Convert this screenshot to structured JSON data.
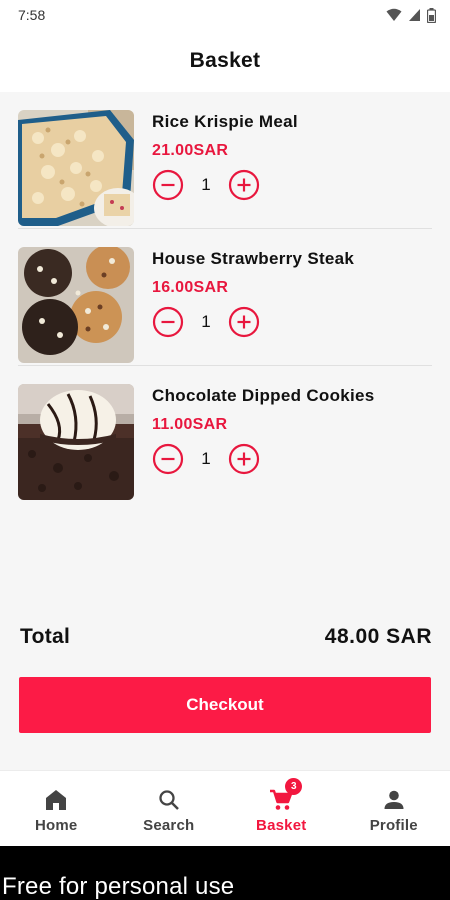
{
  "status_bar": {
    "time": "7:58"
  },
  "header": {
    "title": "Basket"
  },
  "items": [
    {
      "name": "Rice Krispie Meal",
      "price": "21.00SAR",
      "quantity": "1",
      "image": "rice-krispie-image"
    },
    {
      "name": "House Strawberry Steak",
      "price": "16.00SAR",
      "quantity": "1",
      "image": "cookie-image"
    },
    {
      "name": "Chocolate Dipped Cookies",
      "price": "11.00SAR",
      "quantity": "1",
      "image": "brownie-icecream-image"
    }
  ],
  "summary": {
    "total_label": "Total",
    "total_value": "48.00 SAR"
  },
  "checkout": {
    "label": "Checkout"
  },
  "nav": {
    "home": "Home",
    "search": "Search",
    "basket": "Basket",
    "basket_badge": "3",
    "profile": "Profile",
    "active": "basket"
  },
  "watermark": {
    "text": "Free for personal use"
  },
  "colors": {
    "accent": "#fc1b46",
    "price": "#e8173e",
    "background": "#f6f6f6"
  }
}
